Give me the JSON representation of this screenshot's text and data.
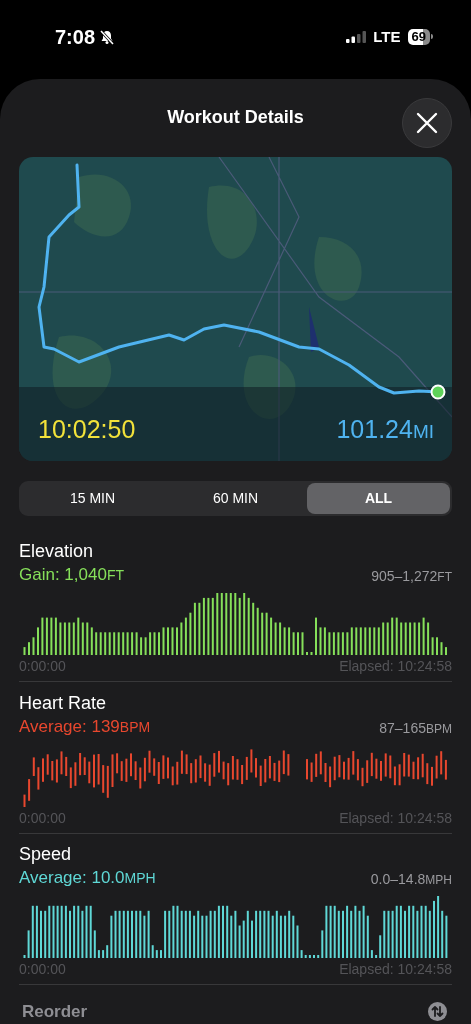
{
  "status_bar": {
    "time": "7:08",
    "network": "LTE",
    "battery": "69"
  },
  "sheet": {
    "title": "Workout Details"
  },
  "map": {
    "duration": "10:02:50",
    "distance": "101.24",
    "distance_unit": "MI"
  },
  "range_tabs": [
    {
      "label": "15 MIN",
      "selected": false
    },
    {
      "label": "60 MIN",
      "selected": false
    },
    {
      "label": "ALL",
      "selected": true
    }
  ],
  "metrics": [
    {
      "kind": "bars",
      "title": "Elevation",
      "summary": "Gain: 1,040",
      "summary_unit": "FT",
      "range": "905–1,272",
      "range_unit": "FT",
      "color": "#86e05a",
      "start": "0:00:00",
      "end": "Elapsed: 10:24:58"
    },
    {
      "kind": "ranges",
      "title": "Heart Rate",
      "summary": "Average: 139",
      "summary_unit": "BPM",
      "range": "87–165",
      "range_unit": "BPM",
      "color": "#e8472e",
      "start": "0:00:00",
      "end": "Elapsed: 10:24:58"
    },
    {
      "kind": "bars",
      "title": "Speed",
      "summary": "Average: 10.0",
      "summary_unit": "MPH",
      "range": "0.0–14.8",
      "range_unit": "MPH",
      "color": "#5fd8d6",
      "start": "0:00:00",
      "end": "Elapsed: 10:24:58"
    }
  ],
  "footer": {
    "label": "Reorder"
  }
}
